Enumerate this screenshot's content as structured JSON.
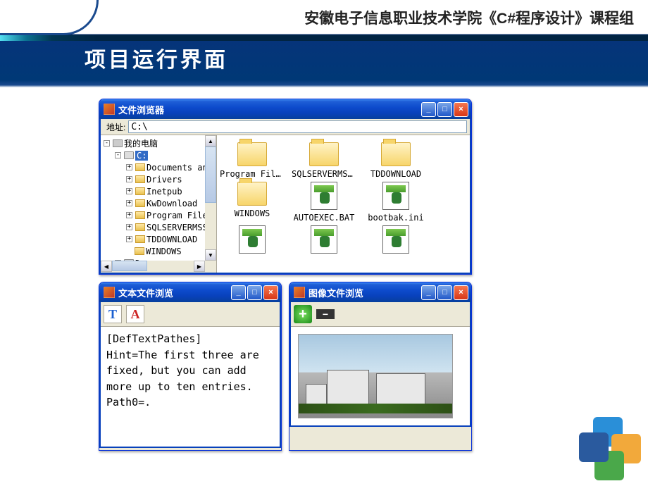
{
  "header": "安徽电子信息职业技术学院《C#程序设计》课程组",
  "slide_title": "项目运行界面",
  "browser": {
    "title": "文件浏览器",
    "addr_label": "地址:",
    "addr_value": "C:\\",
    "tree": {
      "root": "我的电脑",
      "drive_c": "C:",
      "folders": [
        "Documents and",
        "Drivers",
        "Inetpub",
        "KwDownload",
        "Program Files",
        "SQLSERVERMSSQ",
        "TDDOWNLOAD",
        "WINDOWS"
      ],
      "drive_d": "D:"
    },
    "files": [
      {
        "name": "Program Files",
        "type": "folder"
      },
      {
        "name": "SQLSERVERMS...",
        "type": "folder"
      },
      {
        "name": "TDDOWNLOAD",
        "type": "folder"
      },
      {
        "name": "WINDOWS",
        "type": "folder"
      },
      {
        "name": "AUTOEXEC.BAT",
        "type": "file"
      },
      {
        "name": "bootbak.ini",
        "type": "file"
      }
    ]
  },
  "text_viewer": {
    "title": "文本文件浏览",
    "content": "[DefTextPathes]\nHint=The first three are fixed, but you can add more up to ten entries.\nPath0=."
  },
  "image_viewer": {
    "title": "图像文件浏览"
  },
  "buttons": {
    "min": "_",
    "max": "□",
    "close": "×",
    "expand": "+",
    "collapse": "-"
  }
}
